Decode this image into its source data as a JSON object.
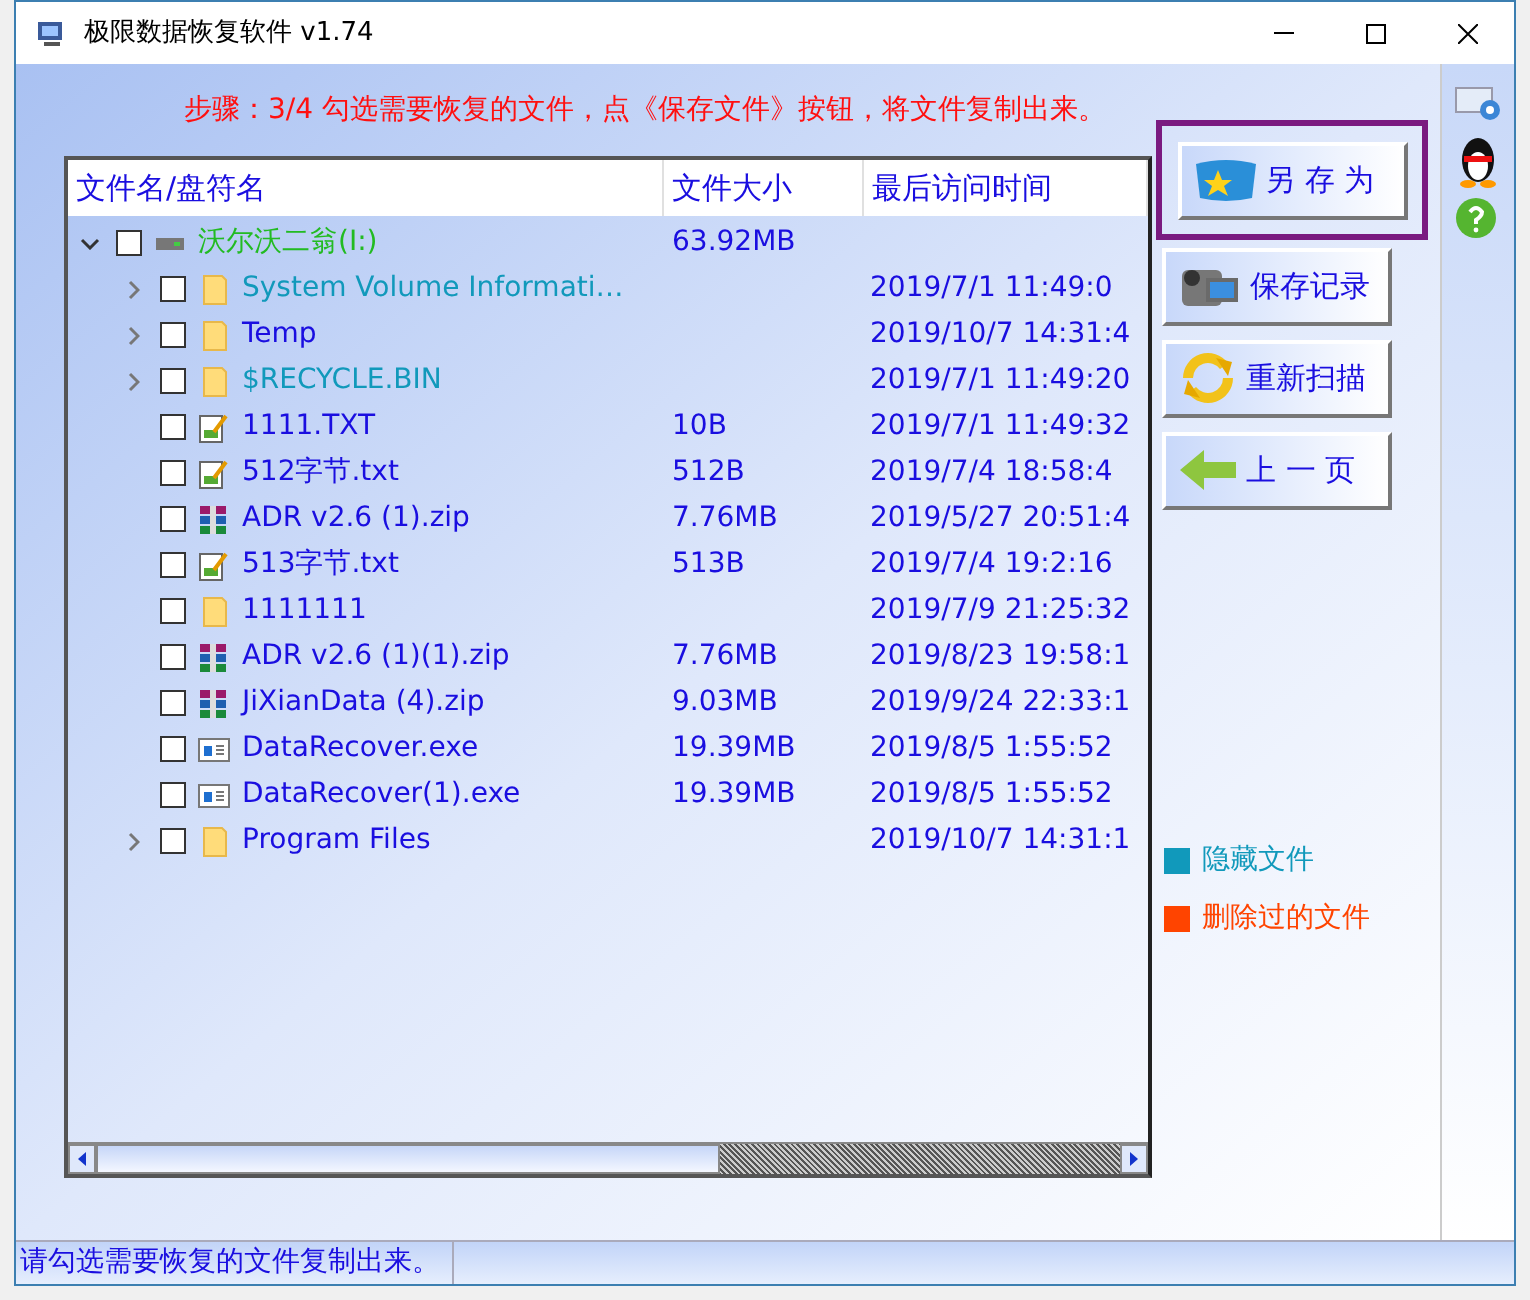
{
  "window": {
    "title": "极限数据恢复软件 v1.74"
  },
  "step_text": "步骤：3/4 勾选需要恢复的文件，点《保存文件》按钮，将文件复制出来。",
  "table": {
    "columns": [
      "文件名/盘符名",
      "文件大小",
      "最后访问时间"
    ],
    "rows": [
      {
        "kind": "drive",
        "name": "沃尔沃二翁(I:)",
        "size": "63.92MB",
        "color": "#22bb22",
        "checked": false,
        "expanded": true,
        "children": [
          {
            "kind": "folder",
            "name": "System Volume Informati…",
            "time": "2019/7/1 11:49:0",
            "color": "#1199bb",
            "checked": false,
            "expanded": false
          },
          {
            "kind": "folder",
            "name": "Temp",
            "time": "2019/10/7 14:31:4",
            "color": "#1a0ee0",
            "checked": false,
            "expanded": false
          },
          {
            "kind": "folder",
            "name": "$RECYCLE.BIN",
            "time": "2019/7/1 11:49:20",
            "color": "#1199bb",
            "checked": false,
            "expanded": false
          },
          {
            "kind": "txt",
            "name": "1111.TXT",
            "size": "10B",
            "time": "2019/7/1 11:49:32",
            "color": "#1a0ee0",
            "checked": false
          },
          {
            "kind": "txt",
            "name": "512字节.txt",
            "size": "512B",
            "time": "2019/7/4 18:58:4",
            "color": "#1a0ee0",
            "checked": false
          },
          {
            "kind": "zip",
            "name": "ADR v2.6 (1).zip",
            "size": "7.76MB",
            "time": "2019/5/27 20:51:4",
            "color": "#1a0ee0",
            "checked": false
          },
          {
            "kind": "txt",
            "name": "513字节.txt",
            "size": "513B",
            "time": "2019/7/4 19:2:16",
            "color": "#1a0ee0",
            "checked": false
          },
          {
            "kind": "folder",
            "name": "1111111",
            "time": "2019/7/9 21:25:32",
            "color": "#1a0ee0",
            "checked": false
          },
          {
            "kind": "zip",
            "name": "ADR v2.6 (1)(1).zip",
            "size": "7.76MB",
            "time": "2019/8/23 19:58:1",
            "color": "#1a0ee0",
            "checked": false
          },
          {
            "kind": "zip",
            "name": "JiXianData (4).zip",
            "size": "9.03MB",
            "time": "2019/9/24 22:33:1",
            "color": "#1a0ee0",
            "checked": false
          },
          {
            "kind": "exe",
            "name": "DataRecover.exe",
            "size": "19.39MB",
            "time": "2019/8/5 1:55:52",
            "color": "#1a0ee0",
            "checked": false
          },
          {
            "kind": "exe",
            "name": "DataRecover(1).exe",
            "size": "19.39MB",
            "time": "2019/8/5 1:55:52",
            "color": "#1a0ee0",
            "checked": false
          },
          {
            "kind": "folder",
            "name": "Program Files",
            "time": "2019/10/7 14:31:1",
            "color": "#1a0ee0",
            "checked": false,
            "expanded": false
          }
        ]
      }
    ]
  },
  "buttons": [
    {
      "kind": "save-as",
      "label": "另 存 为",
      "highlighted": true
    },
    {
      "kind": "record",
      "label": "保存记录",
      "highlighted": false
    },
    {
      "kind": "rescan",
      "label": "重新扫描",
      "highlighted": false
    },
    {
      "kind": "back",
      "label": "上 一 页",
      "highlighted": false
    }
  ],
  "legend": [
    {
      "label": "隐藏文件",
      "color": "#1199bb"
    },
    {
      "label": "删除过的文件",
      "color": "#ff4400"
    }
  ],
  "status_bar": "请勾选需要恢复的文件复制出来。"
}
